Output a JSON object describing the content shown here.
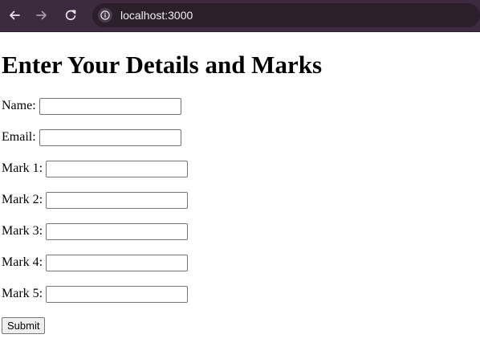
{
  "browser": {
    "url": "localhost:3000",
    "icons": {
      "back": "back-arrow-icon",
      "forward": "forward-arrow-icon",
      "reload": "reload-icon",
      "site_info": "info-icon"
    }
  },
  "page": {
    "title": "Enter Your Details and Marks",
    "fields": [
      {
        "label": "Name:",
        "value": "",
        "placeholder": ""
      },
      {
        "label": "Email:",
        "value": "",
        "placeholder": ""
      },
      {
        "label": "Mark 1:",
        "value": "",
        "placeholder": ""
      },
      {
        "label": "Mark 2:",
        "value": "",
        "placeholder": ""
      },
      {
        "label": "Mark 3:",
        "value": "",
        "placeholder": ""
      },
      {
        "label": "Mark 4:",
        "value": "",
        "placeholder": ""
      },
      {
        "label": "Mark 5:",
        "value": "",
        "placeholder": ""
      }
    ],
    "submit_label": "Submit"
  },
  "colors": {
    "browser_bar": "#3c2a3f",
    "omnibox": "#2a1f2b",
    "page_background": "#ffffff",
    "text": "#000000"
  }
}
